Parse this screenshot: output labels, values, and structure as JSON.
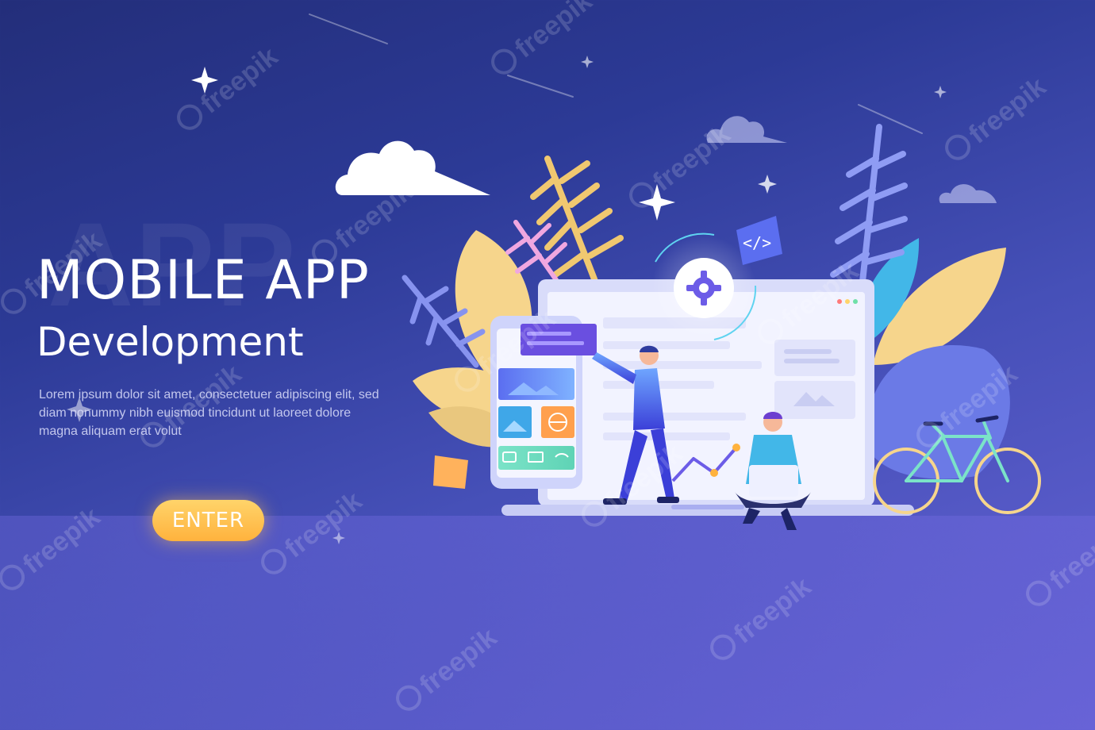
{
  "hero": {
    "background_word": "APP",
    "title": "MOBILE APP",
    "subtitle": "Development",
    "body_lines": [
      "Lorem ipsum dolor sit amet, consectetuer adipiscing elit, sed",
      "diam nonummy nibh euismod tincidunt ut laoreet dolore",
      "magna aliquam erat volut"
    ],
    "cta_label": "ENTER"
  },
  "illustration": {
    "code_tag": "</>",
    "icons": [
      "gear-icon",
      "code-tag-icon",
      "image-icon",
      "globe-icon",
      "camera-icon",
      "mail-icon",
      "wifi-icon"
    ]
  },
  "watermark": {
    "text": "freepik"
  },
  "colors": {
    "background_top": "#232e7a",
    "background_bottom": "#6763d6",
    "accent_orange": "#ffb23d",
    "accent_purple": "#6c5ce7",
    "leaf_yellow": "#f6d58c",
    "leaf_blue": "#7f8ef0"
  }
}
